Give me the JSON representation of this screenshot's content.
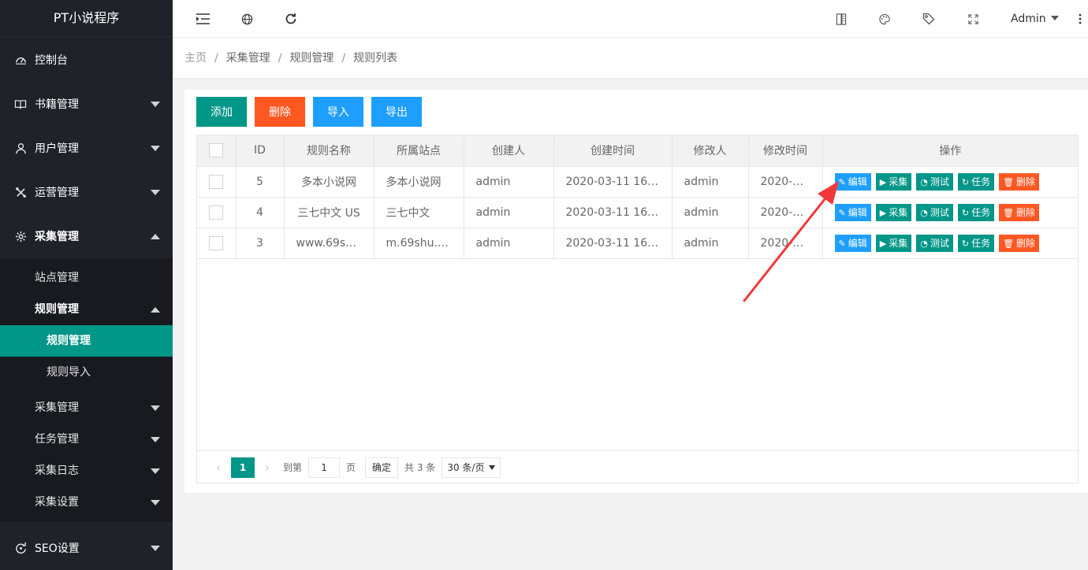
{
  "app": {
    "title": "PT小说程序"
  },
  "sidebar": {
    "items": [
      {
        "label": "控制台",
        "icon": "dashboard-icon"
      },
      {
        "label": "书籍管理",
        "icon": "book-icon"
      },
      {
        "label": "用户管理",
        "icon": "user-icon"
      },
      {
        "label": "运营管理",
        "icon": "operate-icon"
      },
      {
        "label": "采集管理",
        "icon": "gear-icon"
      }
    ],
    "sub": {
      "site": "站点管理",
      "rule": "规则管理",
      "rule_manage": "规则管理",
      "rule_import": "规则导入",
      "collect": "采集管理",
      "task": "任务管理",
      "log": "采集日志",
      "settings": "采集设置"
    },
    "seo": "SEO设置"
  },
  "header": {
    "user": "Admin"
  },
  "breadcrumb": {
    "home": "主页",
    "level1": "采集管理",
    "level2": "规则管理",
    "current": "规则列表"
  },
  "toolbar": {
    "add": "添加",
    "delete": "删除",
    "import": "导入",
    "export": "导出"
  },
  "table": {
    "headers": {
      "id": "ID",
      "name": "规则名称",
      "site": "所属站点",
      "creator": "创建人",
      "created": "创建时间",
      "modifier": "修改人",
      "modified": "修改时间",
      "ops": "操作"
    },
    "rows": [
      {
        "id": "5",
        "name": "多本小说网",
        "site": "多本小说网",
        "creator": "admin",
        "created": "2020-03-11 16:4…",
        "modifier": "admin",
        "modified": "2020-0…"
      },
      {
        "id": "4",
        "name": "三七中文 US",
        "site": "三七中文",
        "creator": "admin",
        "created": "2020-03-11 16:2…",
        "modifier": "admin",
        "modified": "2020-0…"
      },
      {
        "id": "3",
        "name": "www.69sh…",
        "site": "m.69shu.org",
        "creator": "admin",
        "created": "2020-03-11 16:2…",
        "modifier": "admin",
        "modified": "2020-0…"
      }
    ],
    "ops": {
      "edit": "编辑",
      "collect": "采集",
      "test": "测试",
      "task": "任务",
      "delete": "删除"
    }
  },
  "pager": {
    "current": "1",
    "goto": "到第",
    "page": "页",
    "jump_value": "1",
    "ok": "确定",
    "total": "共 3 条",
    "size": "30 条/页"
  },
  "colors": {
    "primary": "#009688",
    "danger": "#ff5722",
    "info": "#1e9fff",
    "sidebar": "#20222a",
    "annotation": "#f0383b"
  }
}
